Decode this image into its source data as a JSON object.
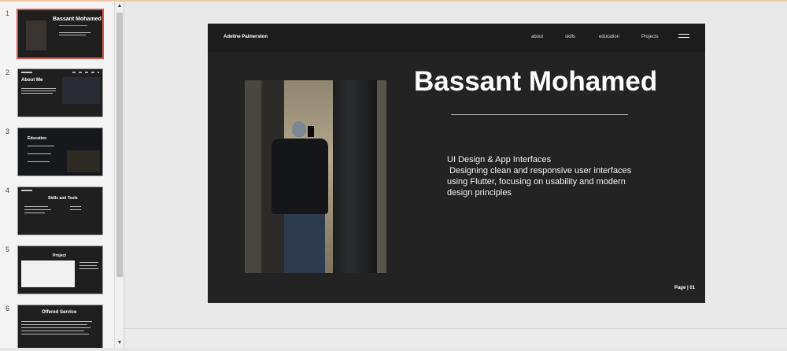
{
  "slides": [
    {
      "number": "1",
      "title": "Bassant Mohamed"
    },
    {
      "number": "2",
      "title": "About Me"
    },
    {
      "number": "3",
      "title": "Education"
    },
    {
      "number": "4",
      "title": "Skills and Tools"
    },
    {
      "number": "5",
      "title": "Project"
    },
    {
      "number": "6",
      "title": "Offered Service"
    }
  ],
  "slide": {
    "brand": "Adeline Palmerston",
    "nav": [
      "about",
      "skills",
      "education",
      "Projects"
    ],
    "title": "Bassant Mohamed",
    "description": "UI Design & App Interfaces\n Designing clean and responsive user interfaces using Flutter, focusing on usability and modern design principles",
    "page_label": "Page  |  01"
  },
  "icons": {
    "scroll_up": "scroll-up-arrow",
    "scroll_down": "scroll-down-arrow",
    "menu": "hamburger-menu-icon"
  },
  "colors": {
    "active_border": "#d9534f",
    "slide_bg": "#232323"
  }
}
